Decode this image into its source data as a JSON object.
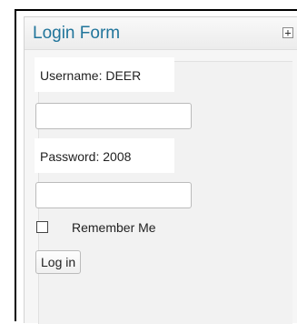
{
  "widget": {
    "title": "Login Form",
    "toggle_symbol": "+",
    "toggle_icon": "plus-icon"
  },
  "form": {
    "username_label": "Username: DEER",
    "password_label": "Password: 2008",
    "username_value": "",
    "password_value": "",
    "remember_label": "Remember Me",
    "remember_checked": false,
    "login_button_label": "Log in"
  },
  "colors": {
    "title": "#21759b",
    "panel_background": "#f6f6f6",
    "frame_border": "#000000"
  }
}
